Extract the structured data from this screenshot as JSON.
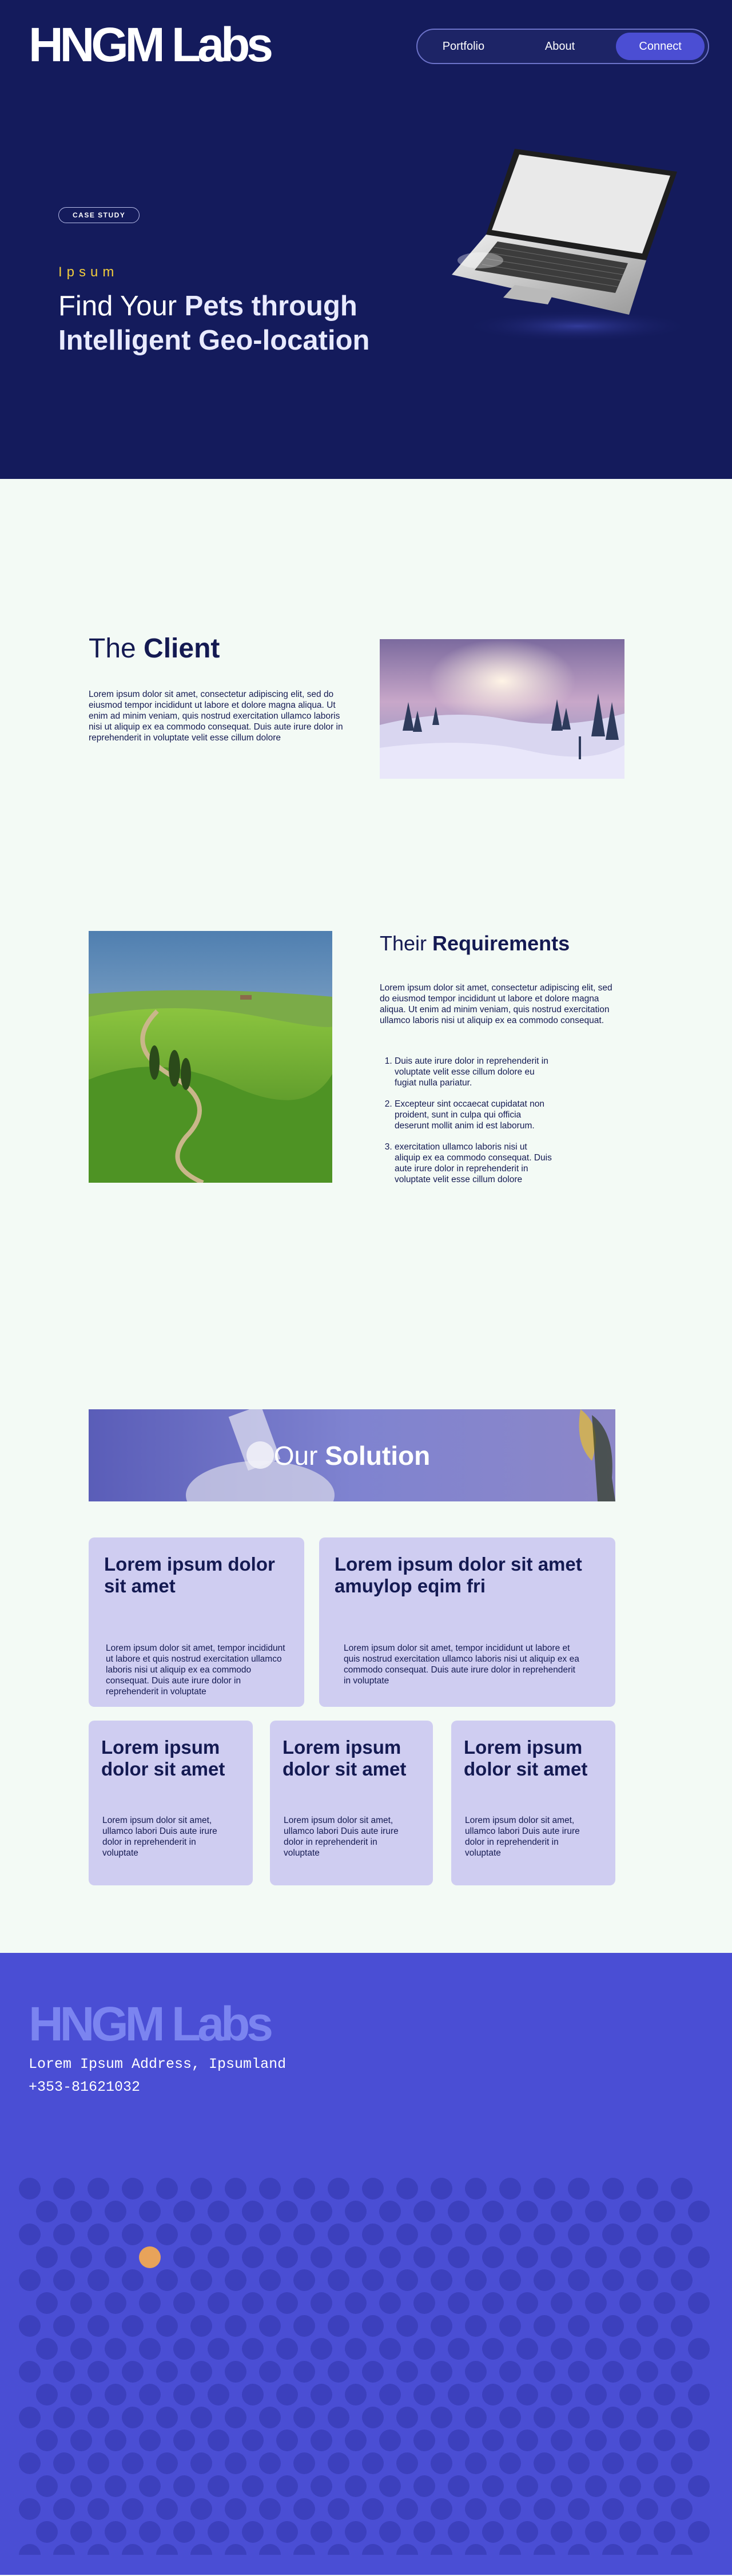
{
  "brand": {
    "logo": "HNGM Labs"
  },
  "nav": {
    "portfolio": "Portfolio",
    "about": "About",
    "connect": "Connect"
  },
  "hero": {
    "badge": "CASE STUDY",
    "eyebrow": "Ipsum",
    "title_light": "Find Your ",
    "title_bold_1": "Pets through",
    "title_bold_2": "Intelligent Geo-location"
  },
  "client": {
    "title_light": "The ",
    "title_bold": "Client",
    "body": "Lorem ipsum dolor sit amet, consectetur adipiscing elit, sed do eiusmod  tempor incididunt ut labore et dolore magna aliqua. Ut enim ad minim  veniam, quis nostrud exercitation ullamco laboris nisi ut aliquip ex ea  commodo consequat. Duis aute irure dolor in reprehenderit in voluptate  velit esse cillum dolore"
  },
  "requirements": {
    "title_light": "Their ",
    "title_bold": "Requirements",
    "body": "Lorem ipsum dolor sit amet, consectetur adipiscing elit, sed do eiusmod  tempor incididunt ut labore et dolore magna aliqua. Ut enim ad minim  veniam, quis nostrud exercitation ullamco laboris nisi ut aliquip ex ea  commodo consequat.",
    "items": [
      "Duis aute irure dolor in reprehenderit in voluptate  velit esse cillum dolore eu fugiat nulla pariatur.",
      "Excepteur sint  occaecat cupidatat non proident, sunt in culpa qui officia deserunt  mollit anim id est laborum.",
      "exercitation ullamco laboris nisi ut aliquip ex ea commodo consequat. Duis aute irure dolor in reprehenderit in voluptate velit esse cillum  dolore"
    ]
  },
  "solution": {
    "title_light": "Our ",
    "title_bold": "Solution",
    "cards": [
      {
        "title": "Lorem ipsum dolor sit amet",
        "body": "Lorem ipsum dolor sit amet,  tempor incididunt ut labore et quis nostrud exercitation ullamco laboris nisi ut aliquip ex ea  commodo  consequat. Duis aute irure dolor in reprehenderit in voluptate"
      },
      {
        "title": "Lorem ipsum dolor sit amet amuylop eqim fri",
        "body": "Lorem ipsum dolor sit amet,  tempor incididunt ut labore et quis nostrud exercitation ullamco laboris nisi ut aliquip ex ea commodo  consequat. Duis aute irure dolor in reprehenderit in voluptate"
      },
      {
        "title": "Lorem ipsum dolor sit amet",
        "body": "Lorem ipsum dolor sit amet, ullamco labori Duis aute irure dolor in reprehenderit in voluptate"
      },
      {
        "title": "Lorem ipsum dolor sit amet",
        "body": "Lorem ipsum dolor sit amet, ullamco labori Duis aute irure dolor in reprehenderit in voluptate"
      },
      {
        "title": "Lorem ipsum dolor sit amet",
        "body": "Lorem ipsum dolor sit amet, ullamco labori Duis aute irure dolor in reprehenderit in voluptate"
      }
    ]
  },
  "footer": {
    "logo": "HNGM Labs",
    "address": "Lorem Ipsum Address, Ipsumland",
    "phone": "+353-81621032"
  },
  "colors": {
    "hero_bg": "#141b5c",
    "accent": "#4b4ed3",
    "eyebrow": "#f1cc3c",
    "card_bg": "#cfcdf1",
    "footer_bg": "#4a4ed4",
    "dot": "#3c40bd",
    "highlight_dot": "#e8a35a"
  }
}
